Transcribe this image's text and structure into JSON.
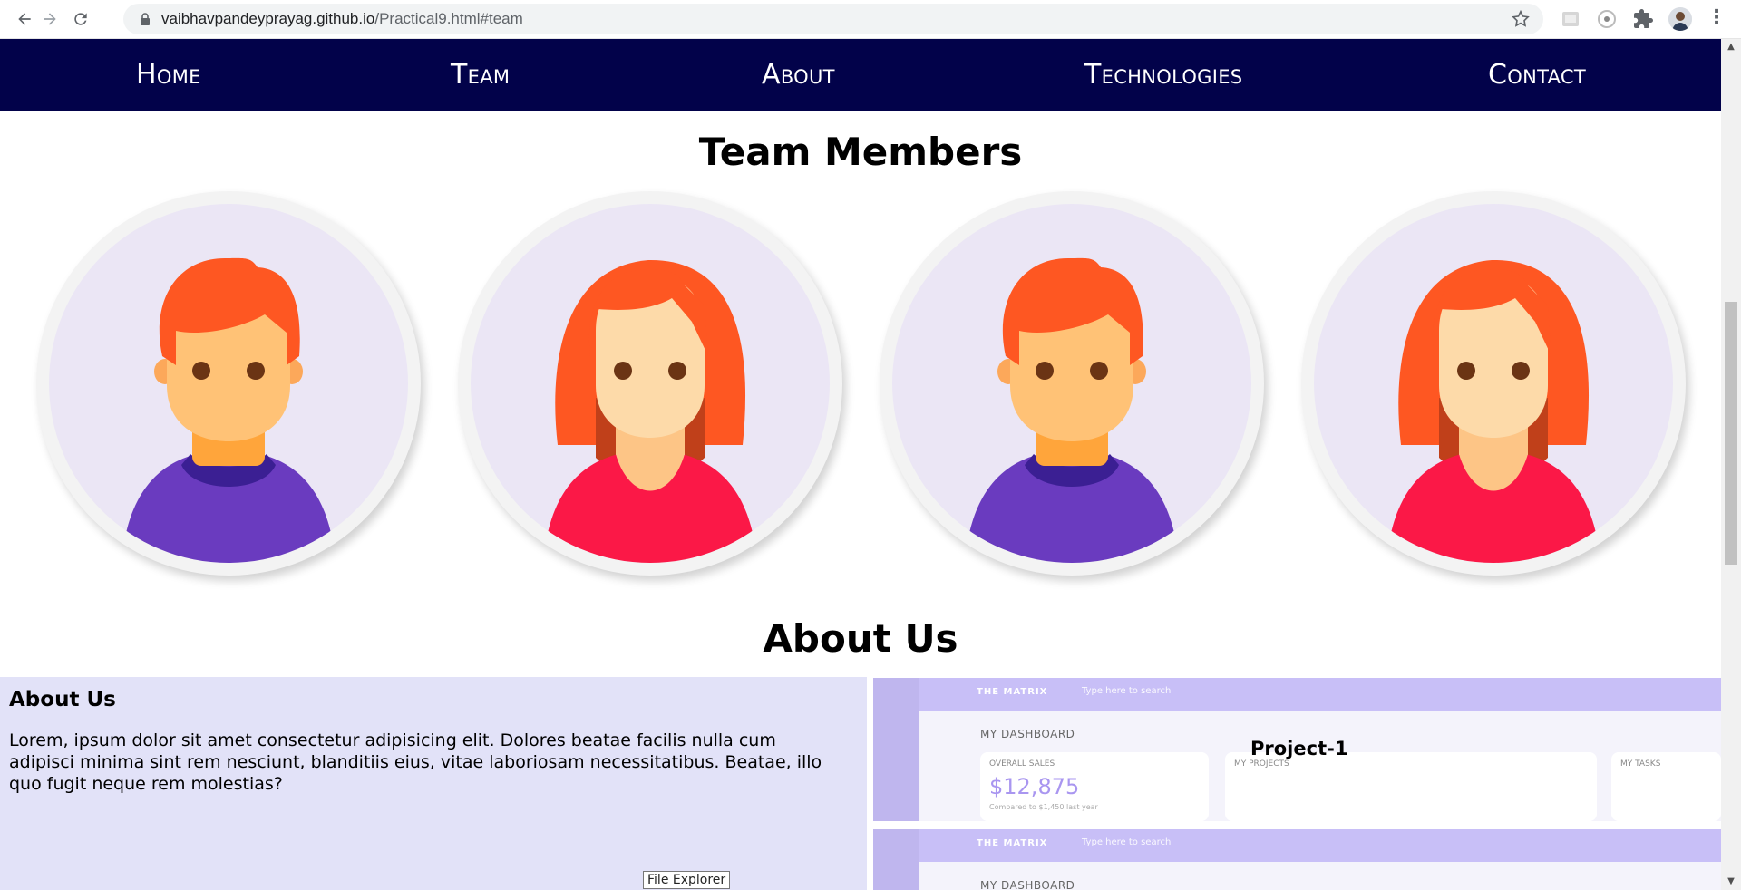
{
  "browser": {
    "url_host": "vaibhavpandeyprayag.github.io",
    "url_path": "/Practical9.html#team",
    "icons": {
      "back": "back-arrow-icon",
      "forward": "forward-arrow-icon",
      "reload": "reload-icon",
      "lock": "lock-icon",
      "bookmark": "star-icon",
      "extension_1": "extension-icon",
      "extension_2": "extension-icon",
      "extensions": "puzzle-icon",
      "profile": "profile-avatar",
      "menu": "kebab-menu-icon"
    }
  },
  "nav": {
    "items": [
      {
        "label": "Home"
      },
      {
        "label": "Team"
      },
      {
        "label": "About"
      },
      {
        "label": "Technologies"
      },
      {
        "label": "Contact"
      }
    ],
    "background": "#02024a"
  },
  "team": {
    "title": "Team Members",
    "members": [
      {
        "avatar": "male-avatar"
      },
      {
        "avatar": "female-avatar"
      },
      {
        "avatar": "male-avatar"
      },
      {
        "avatar": "female-avatar"
      }
    ]
  },
  "about": {
    "title": "About Us",
    "panel_heading": "About Us",
    "panel_text": "Lorem, ipsum dolor sit amet consectetur adipisicing elit. Dolores beatae facilis nulla cum adipisci minima sint rem nesciunt, blanditiis eius, vitae laboriosam necessitatibus. Beatae, illo quo fugit neque rem molestias?",
    "panel_color": "#e2e2f8"
  },
  "projects": [
    {
      "title": "Project-1",
      "preview": {
        "brand": "THE MATRIX",
        "search": "Type here to search",
        "dashboard": "MY DASHBOARD",
        "sales_label": "OVERALL SALES",
        "sales_value": "$12,875",
        "sales_note": "Compared to $1,450 last year",
        "projects_label": "MY PROJECTS",
        "tasks_label": "MY TASKS"
      }
    },
    {
      "title": "",
      "preview": {
        "brand": "THE MATRIX",
        "search": "Type here to search",
        "dashboard": "MY DASHBOARD"
      }
    }
  ],
  "tooltip": "File Explorer"
}
